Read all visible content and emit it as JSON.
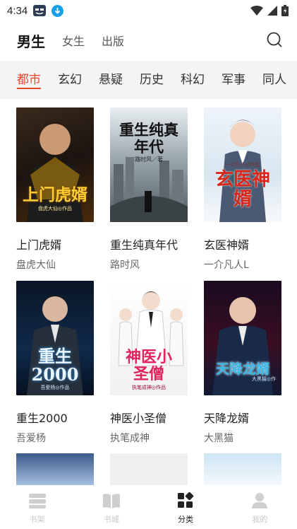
{
  "status_bar": {
    "time": "4:34"
  },
  "top_tabs": [
    {
      "label": "男生",
      "active": true
    },
    {
      "label": "女生",
      "active": false
    },
    {
      "label": "出版",
      "active": false
    }
  ],
  "categories": [
    {
      "label": "都市",
      "active": true
    },
    {
      "label": "玄幻"
    },
    {
      "label": "悬疑"
    },
    {
      "label": "历史"
    },
    {
      "label": "科幻"
    },
    {
      "label": "军事"
    },
    {
      "label": "同人"
    }
  ],
  "books": [
    {
      "title": "上门虎婿",
      "author": "盘虎大仙",
      "cover_text": "上门虎婿",
      "cover_sub": "盘虎大仙◎作品",
      "accent": "#d4a017"
    },
    {
      "title": "重生纯真年代",
      "author": "路时风",
      "cover_text": "重生纯真年代",
      "cover_sub": "路时风／著",
      "accent": "#111111"
    },
    {
      "title": "玄医神婿",
      "author": "一介凡人L",
      "cover_text": "玄医神婿",
      "cover_sub": "一介凡人◎作品",
      "accent": "#e23a2a"
    },
    {
      "title": "重生2000",
      "author": "吾爱杨",
      "cover_text": "重生2000",
      "cover_sub": "吾爱杨◎作品",
      "accent": "#2f8fe0"
    },
    {
      "title": "神医小圣僧",
      "author": "执笔成神",
      "cover_text": "神医小圣僧",
      "cover_sub": "执笔成神◎作品",
      "accent": "#e0245e"
    },
    {
      "title": "天降龙婿",
      "author": "大黑猫",
      "cover_text": "天降龙婿",
      "cover_sub": "大黑猫◎作",
      "accent": "#35b8e8"
    }
  ],
  "bottom_nav": [
    {
      "label": "书架",
      "icon": "bookshelf-icon",
      "active": false
    },
    {
      "label": "书城",
      "icon": "book-icon",
      "active": false
    },
    {
      "label": "分类",
      "icon": "category-icon",
      "active": true
    },
    {
      "label": "我的",
      "icon": "user-icon",
      "active": false
    }
  ],
  "colors": {
    "accent": "#e8462d",
    "strip_bg": "#f4f4f4"
  }
}
